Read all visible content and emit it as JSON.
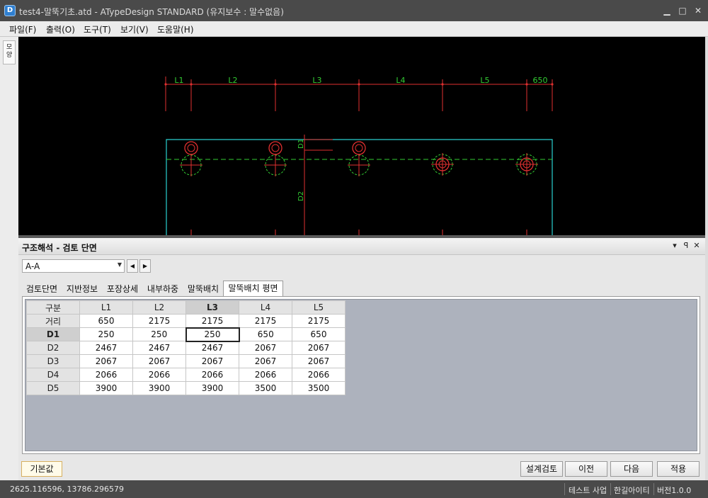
{
  "window": {
    "icon": "app-logo-icon",
    "title": "test4-말뚝기초.atd - ATypeDesign STANDARD (유지보수 : 말수없음)"
  },
  "menu": [
    "파일(F)",
    "출력(O)",
    "도구(T)",
    "보기(V)",
    "도움말(H)"
  ],
  "side_tab": "모양",
  "drawing": {
    "dims": [
      "L1",
      "L2",
      "L3",
      "L4",
      "L5",
      "650"
    ],
    "d1": "D1",
    "d2": "D2",
    "colors": {
      "dim": "#e03030",
      "text": "#33cc33",
      "outline": "#2ad0d0",
      "centerline": "#33cc33",
      "pile": "#e03030"
    }
  },
  "panel": {
    "title": "구조해석 - 검토 단면",
    "section_value": "A-A",
    "tabs": [
      "검토단면",
      "지반정보",
      "포장상세",
      "내부하중",
      "말뚝배치",
      "말뚝배치 평면"
    ],
    "active_tab": 5
  },
  "table": {
    "columns": [
      "구분",
      "L1",
      "L2",
      "L3",
      "L4",
      "L5"
    ],
    "rows": [
      [
        "거리",
        "650",
        "2175",
        "2175",
        "2175",
        "2175"
      ],
      [
        "D1",
        "250",
        "250",
        "250",
        "650",
        "650"
      ],
      [
        "D2",
        "2467",
        "2467",
        "2467",
        "2067",
        "2067"
      ],
      [
        "D3",
        "2067",
        "2067",
        "2067",
        "2067",
        "2067"
      ],
      [
        "D4",
        "2066",
        "2066",
        "2066",
        "2066",
        "2066"
      ],
      [
        "D5",
        "3900",
        "3900",
        "3900",
        "3500",
        "3500"
      ]
    ],
    "selected_col": 3,
    "selected_row": 1
  },
  "buttons": {
    "default": "기본값",
    "review": "설계검토",
    "prev": "이전",
    "next": "다음",
    "apply": "적용"
  },
  "status": {
    "coords": "2625.116596,  13786.296579",
    "company": "테스트 사업",
    "vendor": "한길아이티",
    "version": "버전1.0.0"
  }
}
